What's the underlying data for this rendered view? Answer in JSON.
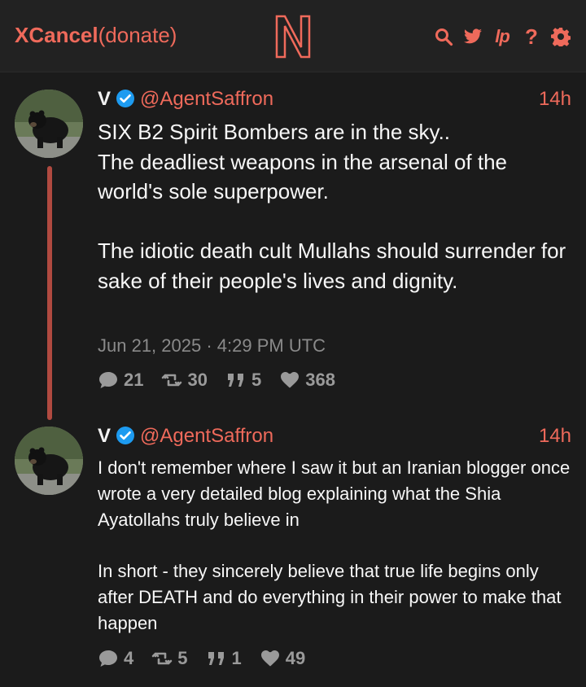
{
  "header": {
    "brand_name": "XCancel",
    "donate": "(donate)",
    "logo_letter": "N",
    "icons": [
      "search-icon",
      "twitter-bird-icon",
      "lp-icon",
      "help-icon",
      "gear-icon"
    ],
    "lp_text": "lp",
    "help_text": "?"
  },
  "colors": {
    "accent": "#ef6a5b",
    "background": "#1b1b1b",
    "topbar": "#222222",
    "verified": "#1d9bf0",
    "thread_line": "#b04a40"
  },
  "tweets": [
    {
      "name": "V",
      "handle": "@AgentSaffron",
      "time": "14h",
      "text": "SIX B2 Spirit Bombers are in the sky..\nThe deadliest weapons in the arsenal of the world's sole superpower.\n\nThe idiotic death cult Mullahs should surrender for sake of their people's lives and dignity.",
      "date": "Jun 21, 2025 · 4:29 PM UTC",
      "replies": "21",
      "retweets": "30",
      "quotes": "5",
      "likes": "368"
    },
    {
      "name": "V",
      "handle": "@AgentSaffron",
      "time": "14h",
      "text": "I don't remember where I saw it but an Iranian blogger once wrote a very detailed blog explaining what the Shia Ayatollahs truly believe in\n\nIn short - they sincerely believe that true life begins only after DEATH and do everything in their power to make that happen",
      "replies": "4",
      "retweets": "5",
      "quotes": "1",
      "likes": "49"
    }
  ]
}
